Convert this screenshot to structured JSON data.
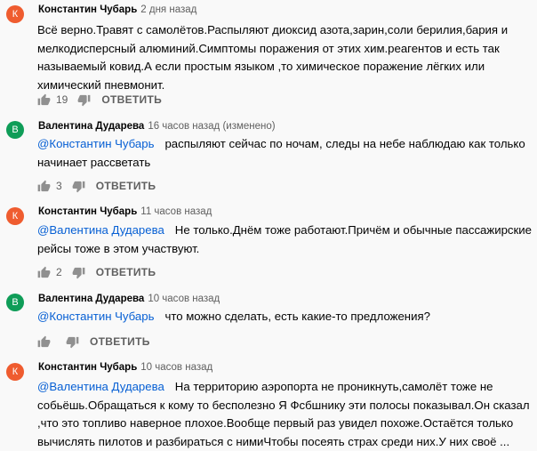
{
  "colors": {
    "avatar_k": "#ef5c2f",
    "avatar_v": "#0f9d58",
    "mention": "#065fd4",
    "meta": "#606060"
  },
  "reply_label": "ОТВЕТИТЬ",
  "comments": [
    {
      "avatar_letter": "К",
      "author": "Константин Чубарь",
      "time": "2 дня назад",
      "mention": "",
      "text": "Всё верно.Травят с самолётов.Распыляют диоксид азота,зарин,соли берилия,бария и\nмелкодисперсный алюминий.Симптомы поражения от этих хим.реагентов и есть так\nназываемый ковид.А если простым языком ,то химическое поражение лёгких или\nхимический пневмонит.",
      "likes": "19"
    },
    {
      "avatar_letter": "В",
      "author": "Валентина Дударева",
      "time": "16 часов назад (изменено)",
      "mention": "@Константин Чубарь",
      "text": "распыляют сейчас по ночам, следы на небе наблюдаю как только\nначинает рассветать",
      "likes": "3"
    },
    {
      "avatar_letter": "К",
      "author": "Константин Чубарь",
      "time": "11 часов назад",
      "mention": "@Валентина Дударева",
      "text": "Не только.Днём тоже работают.Причём и обычные пассажирские\nрейсы тоже в этом участвуют.",
      "likes": "2"
    },
    {
      "avatar_letter": "В",
      "author": "Валентина Дударева",
      "time": "10 часов назад",
      "mention": "@Константин Чубарь",
      "text": "что можно сделать, есть какие-то предложения?",
      "likes": ""
    },
    {
      "avatar_letter": "К",
      "author": "Константин Чубарь",
      "time": "10 часов назад",
      "mention": "@Валентина Дударева",
      "text": "На территорию аэропорта не проникнуть,самолёт тоже не\nсобьёшь.Обращаться к кому то бесполезно Я Фсбшнику эти полосы показывал.Он сказал\n,что это топливо наверное плохое.Вообще первый раз увидел похоже.Остаётся только\nвычислять пилотов и разбираться с нимиЧтобы посеять страх среди них.У них своё ...",
      "likes": ""
    }
  ]
}
